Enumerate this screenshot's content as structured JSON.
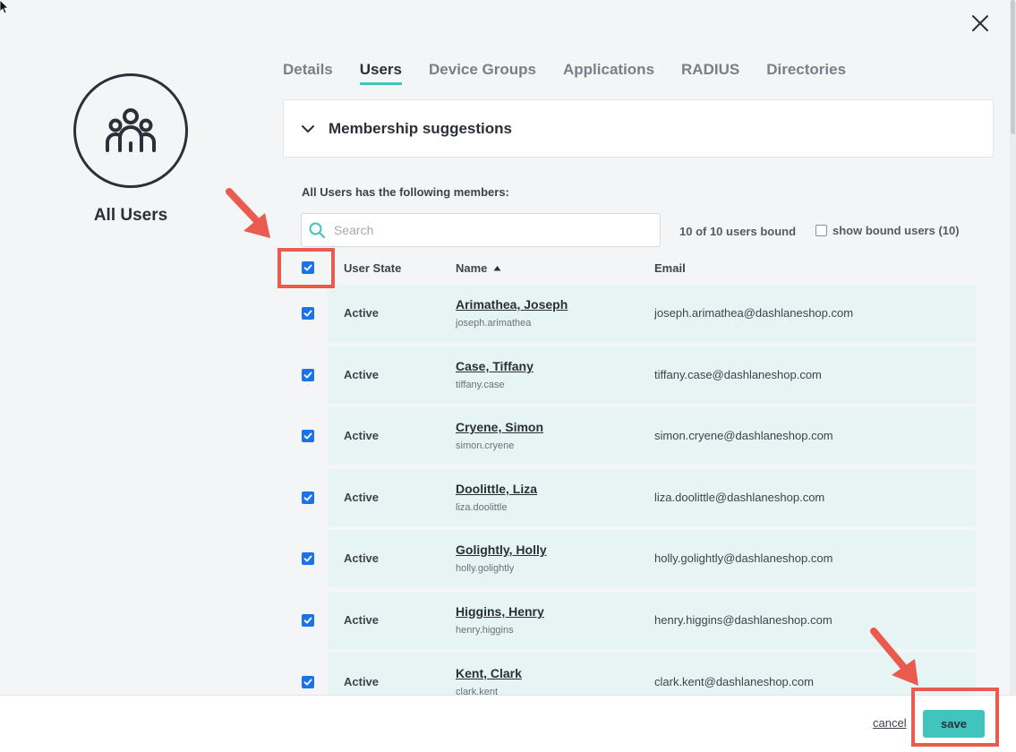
{
  "dialog": {
    "group_name": "All Users",
    "close_icon": "close-icon",
    "avatar_icon": "group-icon"
  },
  "tabs": [
    {
      "label": "Details",
      "active": false
    },
    {
      "label": "Users",
      "active": true
    },
    {
      "label": "Device Groups",
      "active": false
    },
    {
      "label": "Applications",
      "active": false
    },
    {
      "label": "RADIUS",
      "active": false
    },
    {
      "label": "Directories",
      "active": false
    }
  ],
  "suggestions": {
    "label": "Membership suggestions",
    "icon": "chevron-down-icon"
  },
  "members": {
    "heading": "All Users has the following members:",
    "search_placeholder": "Search",
    "bound_count": "10 of 10 users bound",
    "show_bound_label": "show bound users (10)",
    "show_bound_checked": false,
    "select_all_checked": true
  },
  "table": {
    "columns": {
      "state": "User State",
      "name": "Name",
      "email": "Email"
    },
    "sort_icon": "sort-ascending-icon",
    "rows": [
      {
        "checked": true,
        "state": "Active",
        "name": "Arimathea, Joseph",
        "username": "joseph.arimathea",
        "email": "joseph.arimathea@dashlaneshop.com"
      },
      {
        "checked": true,
        "state": "Active",
        "name": "Case, Tiffany",
        "username": "tiffany.case",
        "email": "tiffany.case@dashlaneshop.com"
      },
      {
        "checked": true,
        "state": "Active",
        "name": "Cryene, Simon",
        "username": "simon.cryene",
        "email": "simon.cryene@dashlaneshop.com"
      },
      {
        "checked": true,
        "state": "Active",
        "name": "Doolittle, Liza",
        "username": "liza.doolittle",
        "email": "liza.doolittle@dashlaneshop.com"
      },
      {
        "checked": true,
        "state": "Active",
        "name": "Golightly, Holly",
        "username": "holly.golightly",
        "email": "holly.golightly@dashlaneshop.com"
      },
      {
        "checked": true,
        "state": "Active",
        "name": "Higgins, Henry",
        "username": "henry.higgins",
        "email": "henry.higgins@dashlaneshop.com"
      },
      {
        "checked": true,
        "state": "Active",
        "name": "Kent, Clark",
        "username": "clark.kent",
        "email": "clark.kent@dashlaneshop.com"
      }
    ]
  },
  "footer": {
    "cancel_label": "cancel",
    "save_label": "save"
  },
  "colors": {
    "accent": "#40c4bd",
    "row_band": "#e6f5f4",
    "checkbox": "#1a73e8",
    "annotation": "#ea5b4f"
  }
}
